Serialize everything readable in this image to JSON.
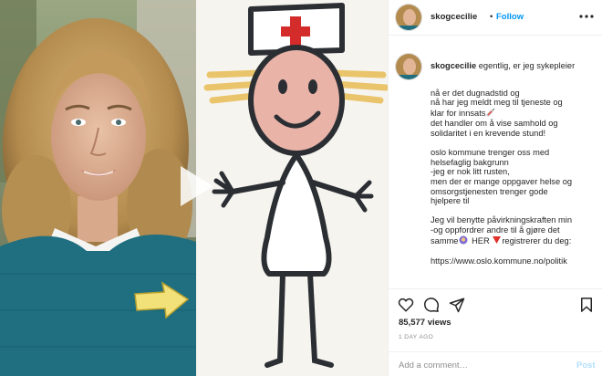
{
  "post": {
    "username": "skogcecilie",
    "follow_label": "Follow",
    "separator": "•",
    "more_label": "•••"
  },
  "caption": {
    "username": "skogcecilie",
    "first_line": "egentlig, er jeg sykepleier",
    "lines": [
      "nå er det dugnadstid og",
      "nå har jeg meldt meg til tjeneste og",
      "klar for innsats",
      "det handler om å vise samhold og",
      "solidaritet i en krevende stund!",
      "",
      "oslo kommune trenger oss med",
      "helsefaglig bakgrunn",
      "-jeg er nok litt rusten,",
      "men der er mange oppgaver helse og",
      "omsorgstjenesten trenger gode",
      "hjelpere til",
      "",
      "Jeg vil benytte påvirkningskraften min",
      "-og oppfordrer andre til å gjøre det",
      "samme",
      "HER",
      "registrerer du deg:",
      "",
      "https://www.oslo.kommune.no/politik"
    ]
  },
  "stats": {
    "views": "85,577 views",
    "age": "1 DAY AGO"
  },
  "comment_box": {
    "placeholder": "Add a comment…",
    "post_label": "Post"
  },
  "icons": {
    "like": "heart-icon",
    "comment": "comment-icon",
    "share": "share-icon",
    "save": "bookmark-icon",
    "play": "play-icon",
    "syringe": "syringe-emoji",
    "raising_hand": "raising-hand-emoji",
    "down_triangle": "red-down-triangle-emoji"
  },
  "colors": {
    "link": "#0095f6",
    "post_disabled": "#b2dffc",
    "muted": "#8e8e8e",
    "text": "#262626"
  }
}
